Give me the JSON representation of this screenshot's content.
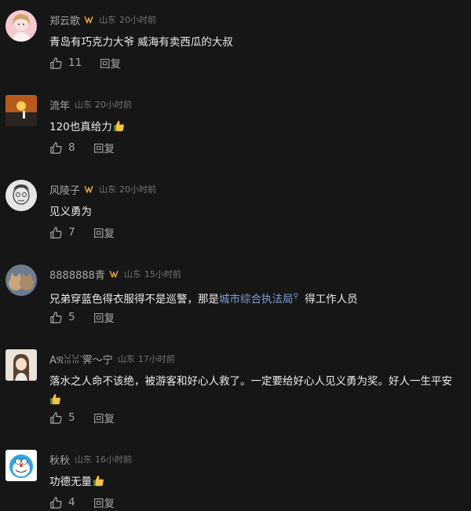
{
  "comments": [
    {
      "username": "郑云歌",
      "location": "山东",
      "time": "20小时前",
      "text": "青岛有巧克力大爷 威海有卖西瓜的大叔",
      "likes": "11",
      "reply": "回复",
      "avatar": "avatar-girl-pink"
    },
    {
      "username": "流年",
      "location": "山东",
      "time": "20小时前",
      "text": "120也真给力",
      "likes": "8",
      "reply": "回复",
      "avatar": "avatar-sunset"
    },
    {
      "username": "风陵子",
      "location": "山东",
      "time": "20小时前",
      "text": "见义勇为",
      "likes": "7",
      "reply": "回复",
      "avatar": "avatar-sketch-face"
    },
    {
      "username": "8888888青",
      "location": "山东",
      "time": "15小时前",
      "text_before": "兄弟穿蓝色得衣服得不是巡警，那是",
      "link_text": "城市综合执法局",
      "text_after": "得工作人员",
      "likes": "5",
      "reply": "回复",
      "avatar": "avatar-cats"
    },
    {
      "username": "Aᥒ꒰ᐢ⸝⸝. ̫ .⸝⸝ᐢ꒱ᐝ霁～宁",
      "username_display": "A𝔑ꈍꈍᐝ霁～宁",
      "location": "山东",
      "time": "17小时前",
      "text": "落水之人命不该绝，被游客和好心人救了。一定要给好心人见义勇为奖。好人一生平安",
      "likes": "5",
      "reply": "回复",
      "avatar": "avatar-woman"
    },
    {
      "username": "秋秋",
      "location": "山东",
      "time": "16小时前",
      "text": "功德无量",
      "likes": "4",
      "reply": "回复",
      "avatar": "avatar-cartoon-cat"
    }
  ],
  "colors": {
    "background": "#161616",
    "username": "#a7a7a7",
    "meta": "#737373",
    "text": "#ececec",
    "link": "#7c9fd6",
    "badge": "#e8a23a"
  }
}
